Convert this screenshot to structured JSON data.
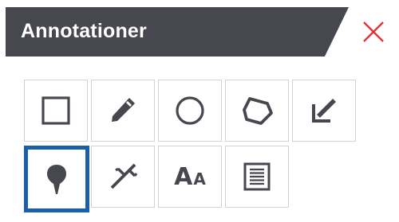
{
  "panel": {
    "title": "Annotationer",
    "close_icon": "close-x-icon",
    "colors": {
      "header_bg": "#47474f",
      "header_text": "#ffffff",
      "close_x": "#e0313a",
      "icon": "#47474f",
      "tool_border": "#d2d2d2",
      "selected_border": "#1a5fa8"
    }
  },
  "tools": [
    {
      "id": "rectangle",
      "icon": "rectangle-icon",
      "selected": false
    },
    {
      "id": "pencil",
      "icon": "pencil-icon",
      "selected": false
    },
    {
      "id": "circle",
      "icon": "circle-icon",
      "selected": false
    },
    {
      "id": "polygon",
      "icon": "polygon-icon",
      "selected": false
    },
    {
      "id": "arrow",
      "icon": "arrow-icon",
      "selected": false
    },
    {
      "id": "marker",
      "icon": "map-pin-icon",
      "selected": true
    },
    {
      "id": "measure",
      "icon": "caliper-icon",
      "selected": false
    },
    {
      "id": "text",
      "icon": "text-size-icon",
      "label_big": "A",
      "label_small": "A",
      "selected": false
    },
    {
      "id": "note",
      "icon": "note-icon",
      "selected": false
    }
  ]
}
